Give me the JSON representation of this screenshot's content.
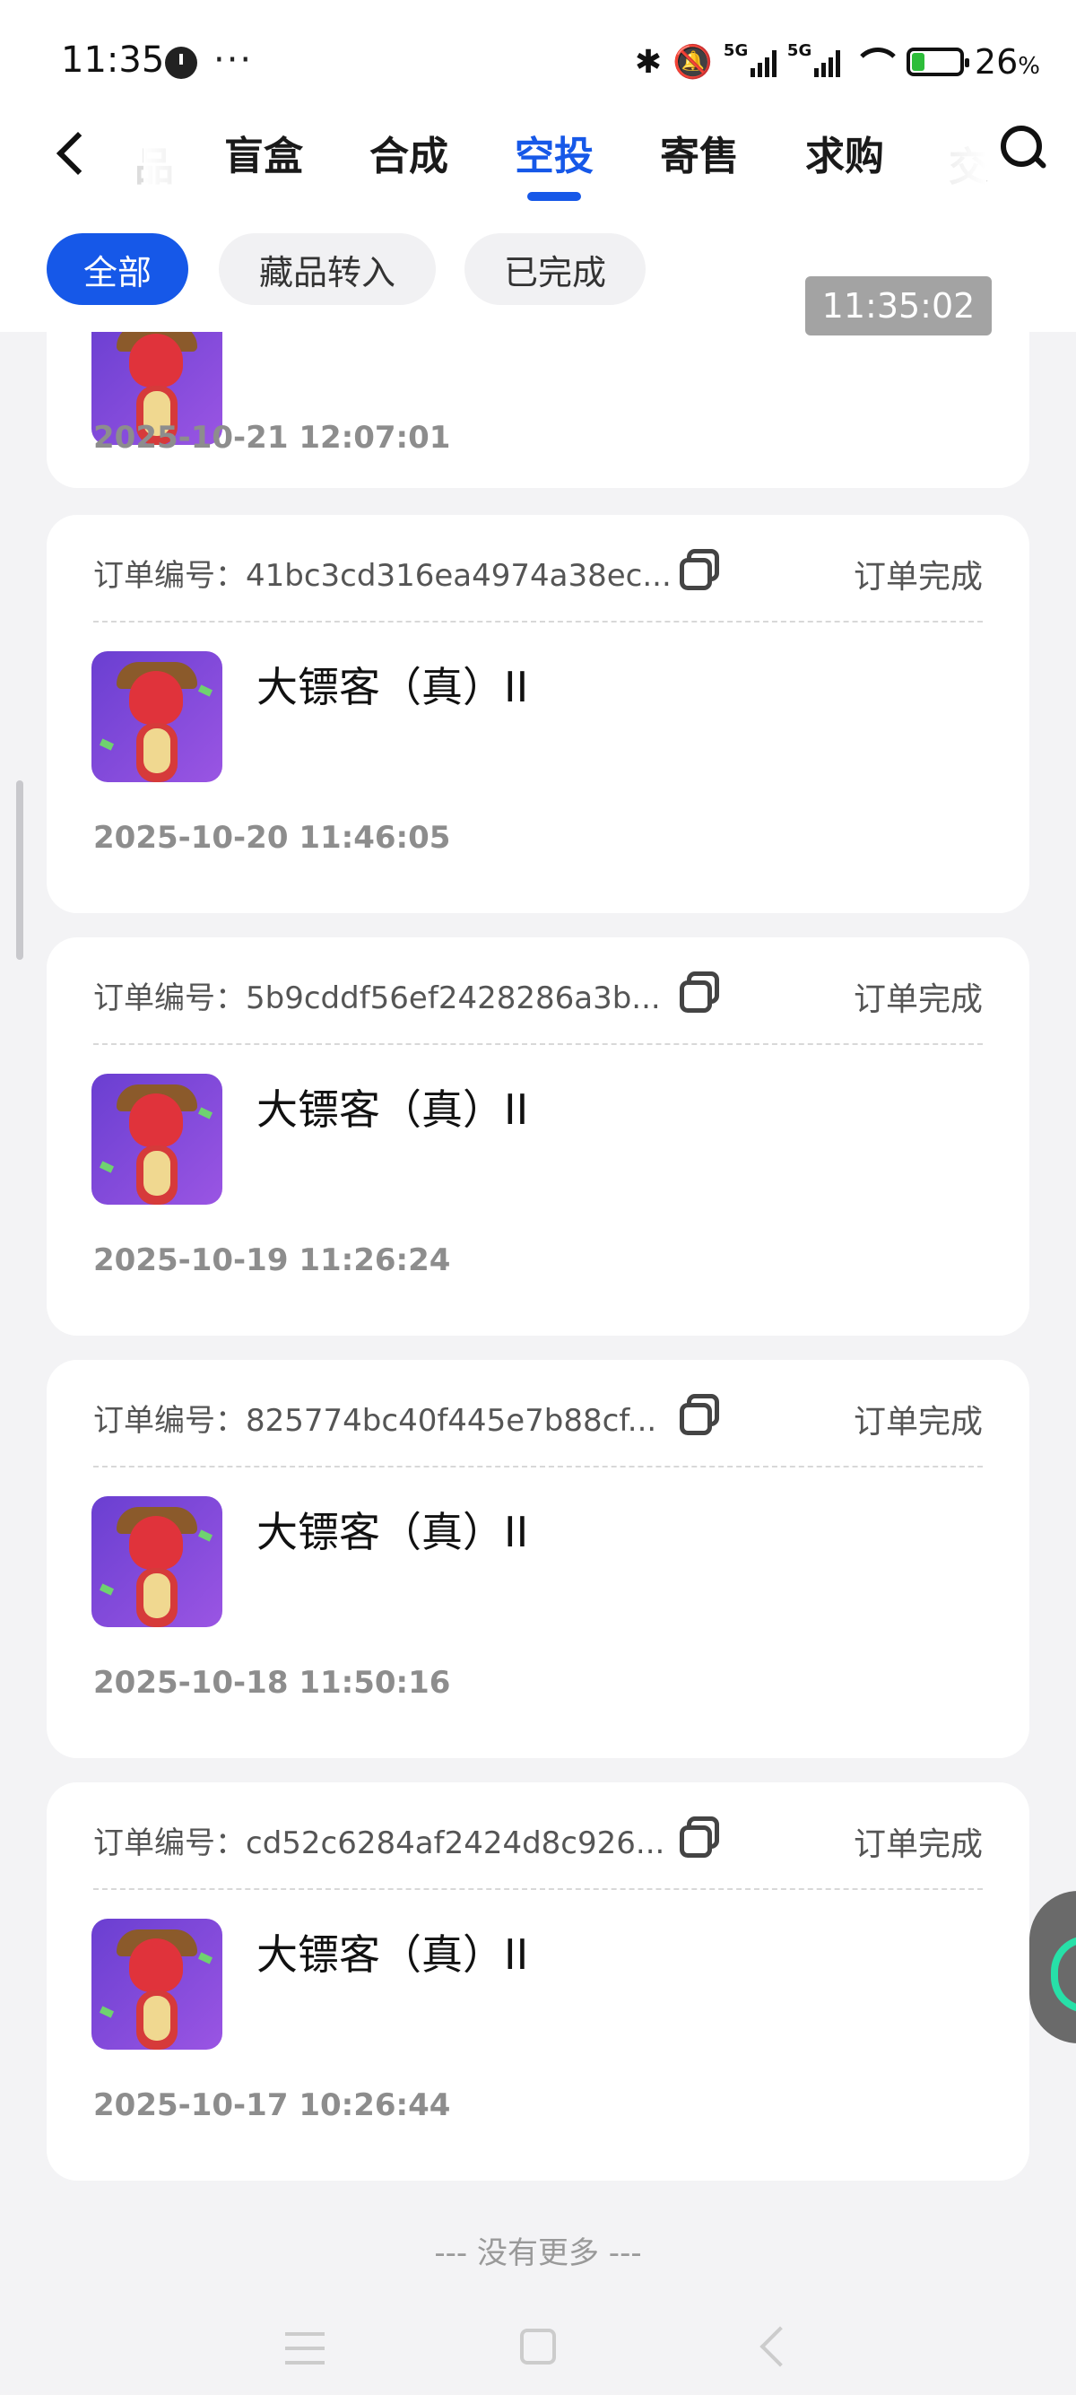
{
  "status_bar": {
    "time": "11:35",
    "more": "···",
    "network": "5G",
    "battery_percent": "26",
    "battery_unit": "%",
    "battery_level": 0.26
  },
  "header": {
    "tabs": [
      "盲盒",
      "合成",
      "空投",
      "寄售",
      "求购"
    ],
    "active_tab": "空投"
  },
  "filters": {
    "chips": [
      "全部",
      "藏品转入",
      "已完成"
    ],
    "active": "全部"
  },
  "time_badge": "11:35:02",
  "orders": {
    "label": "订单编号：",
    "status": "订单完成",
    "partial_date": "2025-10-21 12:07:01",
    "items": [
      {
        "id": "41bc3cd316ea4974a38ec...",
        "name": "大镖客（真）II",
        "date": "2025-10-20 11:46:05"
      },
      {
        "id": "5b9cddf56ef2428286a3b...",
        "name": "大镖客（真）II",
        "date": "2025-10-19 11:26:24"
      },
      {
        "id": "825774bc40f445e7b88cf...",
        "name": "大镖客（真）II",
        "date": "2025-10-18 11:50:16"
      },
      {
        "id": "cd52c6284af2424d8c926...",
        "name": "大镖客（真）II",
        "date": "2025-10-17 10:26:44"
      }
    ]
  },
  "footer": {
    "no_more": "--- 没有更多 ---"
  },
  "colors": {
    "accent": "#1658e8",
    "background": "#f3f3f5",
    "thumb": "#7a48d8"
  }
}
